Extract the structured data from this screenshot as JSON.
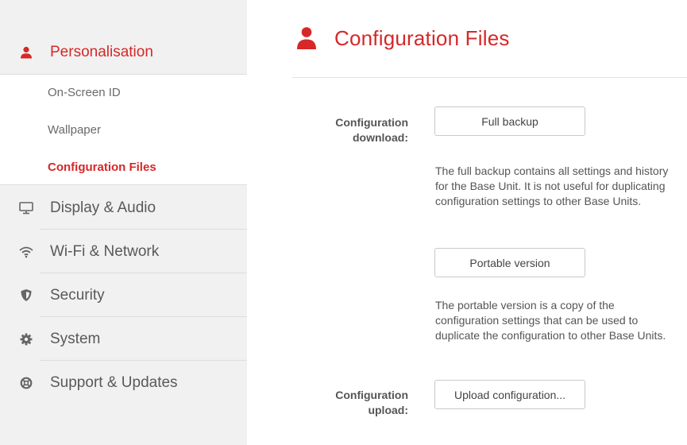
{
  "sidebar": {
    "sections": [
      {
        "label": "Personalisation",
        "icon": "user-icon",
        "active": true
      },
      {
        "label": "Display & Audio",
        "icon": "monitor-icon"
      },
      {
        "label": "Wi-Fi & Network",
        "icon": "wifi-icon"
      },
      {
        "label": "Security",
        "icon": "shield-icon"
      },
      {
        "label": "System",
        "icon": "gear-icon"
      },
      {
        "label": "Support & Updates",
        "icon": "lifebuoy-icon"
      }
    ],
    "subitems": [
      {
        "label": "On-Screen ID"
      },
      {
        "label": "Wallpaper"
      },
      {
        "label": "Configuration Files",
        "active": true
      }
    ]
  },
  "main": {
    "title": "Configuration Files",
    "title_icon": "user-icon",
    "download": {
      "label_line1": "Configuration",
      "label_line2": "download:",
      "full_backup_button": "Full backup",
      "full_backup_desc": "The full backup contains all settings and history for the Base Unit. It is not useful for duplicating configuration settings to other Base Units.",
      "portable_button": "Portable version",
      "portable_desc": "The portable version is a copy of the configuration settings that can be used to duplicate the configuration to other Base Units."
    },
    "upload": {
      "label_line1": "Configuration",
      "label_line2": "upload:",
      "upload_button": "Upload configuration..."
    }
  },
  "colors": {
    "accent": "#d62828",
    "sidebar_bg": "#f1f1f1",
    "text": "#555555"
  }
}
